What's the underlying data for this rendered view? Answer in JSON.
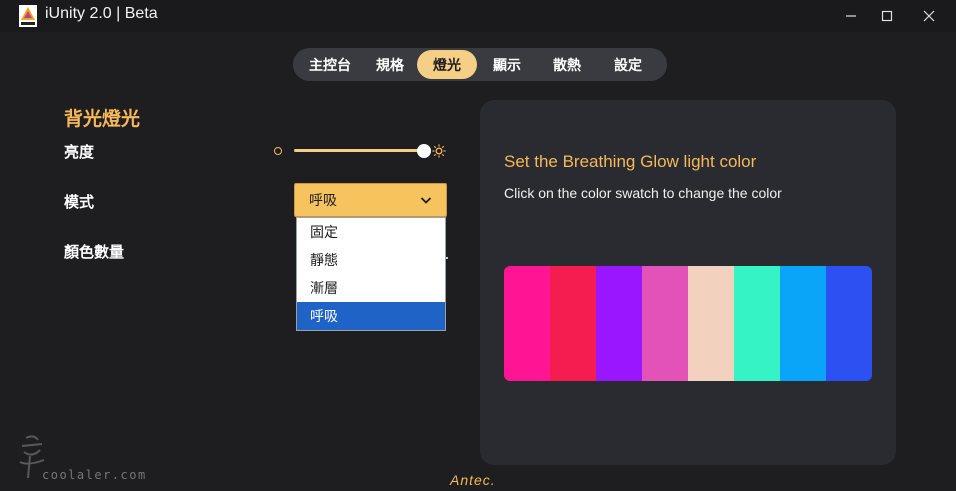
{
  "window": {
    "title": "iUnity 2.0 | Beta",
    "controls": [
      "minimize",
      "maximize",
      "close"
    ]
  },
  "tabs": [
    {
      "label": "主控台",
      "active": false
    },
    {
      "label": "規格",
      "active": false
    },
    {
      "label": "燈光",
      "active": true
    },
    {
      "label": "顯示",
      "active": false
    },
    {
      "label": "散熱",
      "active": false
    },
    {
      "label": "設定",
      "active": false
    }
  ],
  "left_panel": {
    "section_title": "背光燈光",
    "brightness_label": "亮度",
    "brightness_value_fraction": 0.95,
    "mode_label": "模式",
    "mode_selected": "呼吸",
    "mode_options": [
      "固定",
      "靜態",
      "漸層",
      "呼吸"
    ],
    "color_count_label": "顏色數量"
  },
  "right_card": {
    "title": "Set the Breathing Glow light color",
    "subtitle": "Click on the color swatch to change the color",
    "swatches": [
      "#ff1493",
      "#f51d4f",
      "#9a16ff",
      "#e352b8",
      "#f2d1be",
      "#36f3c6",
      "#0aa4f8",
      "#2d50f3"
    ]
  },
  "footer": {
    "brand": "Antec.",
    "watermark": "coolaler.com"
  },
  "colors": {
    "accent": "#f6b859",
    "tab_active": "#f5cf85",
    "selection": "#1f63c7",
    "background": "#1e1e21",
    "card": "#2a2b30"
  }
}
